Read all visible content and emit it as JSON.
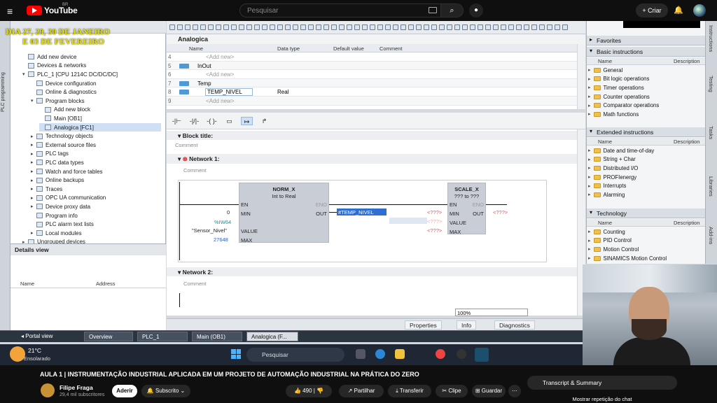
{
  "youtube": {
    "brand": "YouTube",
    "region": "BR",
    "search_placeholder": "Pesquisar",
    "criar_label": "Criar",
    "video_title": "AULA 1 | INSTRUMENTAÇÃO INDUSTRIAL APLICADA EM UM PROJETO DE AUTOMAÇÃO INDUSTRIAL NA PRÁTICA DO ZERO",
    "channel_name": "Filipe Fraga",
    "channel_subs": "29,4 mil subscritores",
    "aderir": "Aderir",
    "subscrito": "Subscrito",
    "likes": "490",
    "partilhar": "Partilhar",
    "transferir": "Transferir",
    "clipe": "Clipe",
    "guardar": "Guardar",
    "transcript": "Transcript & Summary",
    "chat": "Mostrar repetição do chat"
  },
  "overlay": {
    "line1": "DIA 27, 29, 30 DE JANEIRO",
    "line2": "E 03 DE FEVEREIRO"
  },
  "tia": {
    "left_tab": "PLC programming",
    "tree": [
      {
        "label": "Add new device",
        "level": 1,
        "toggle": ""
      },
      {
        "label": "Devices & networks",
        "level": 1,
        "toggle": ""
      },
      {
        "label": "PLC_1 [CPU 1214C DC/DC/DC]",
        "level": 1,
        "toggle": "▾"
      },
      {
        "label": "Device configuration",
        "level": 2,
        "toggle": ""
      },
      {
        "label": "Online & diagnostics",
        "level": 2,
        "toggle": ""
      },
      {
        "label": "Program blocks",
        "level": 2,
        "toggle": "▾"
      },
      {
        "label": "Add new block",
        "level": 3,
        "toggle": ""
      },
      {
        "label": "Main [OB1]",
        "level": 3,
        "toggle": ""
      },
      {
        "label": "Analogica [FC1]",
        "level": 3,
        "toggle": "",
        "selected": true
      },
      {
        "label": "Technology objects",
        "level": 2,
        "toggle": "▸"
      },
      {
        "label": "External source files",
        "level": 2,
        "toggle": "▸"
      },
      {
        "label": "PLC tags",
        "level": 2,
        "toggle": "▸"
      },
      {
        "label": "PLC data types",
        "level": 2,
        "toggle": "▸"
      },
      {
        "label": "Watch and force tables",
        "level": 2,
        "toggle": "▸"
      },
      {
        "label": "Online backups",
        "level": 2,
        "toggle": "▸"
      },
      {
        "label": "Traces",
        "level": 2,
        "toggle": "▸"
      },
      {
        "label": "OPC UA communication",
        "level": 2,
        "toggle": "▸"
      },
      {
        "label": "Device proxy data",
        "level": 2,
        "toggle": "▸"
      },
      {
        "label": "Program info",
        "level": 2,
        "toggle": ""
      },
      {
        "label": "PLC alarm text lists",
        "level": 2,
        "toggle": ""
      },
      {
        "label": "Local modules",
        "level": 2,
        "toggle": "▸"
      },
      {
        "label": "Ungrouped devices",
        "level": 1,
        "toggle": "▸"
      }
    ],
    "details": {
      "title": "Details view",
      "col_name": "Name",
      "col_address": "Address"
    },
    "block_name": "Analogica",
    "iface_cols": {
      "name": "Name",
      "type": "Data type",
      "default": "Default value",
      "comment": "Comment"
    },
    "iface_rows": [
      {
        "n": "4",
        "label": "<Add new>",
        "type": "",
        "kind": "add"
      },
      {
        "n": "5",
        "label": "InOut",
        "type": "",
        "kind": "section"
      },
      {
        "n": "6",
        "label": "<Add new>",
        "type": "",
        "kind": "add"
      },
      {
        "n": "7",
        "label": "Temp",
        "type": "",
        "kind": "section"
      },
      {
        "n": "8",
        "label": "TEMP_NIVEL",
        "type": "Real",
        "kind": "var"
      },
      {
        "n": "9",
        "label": "<Add new>",
        "type": "",
        "kind": "add"
      }
    ],
    "block_title": "Block title:",
    "comment": "Comment",
    "network1": "Network 1:",
    "network2": "Network 2:",
    "norm": {
      "name": "NORM_X",
      "sub": "Int to Real",
      "en": "EN",
      "eno": "ENO",
      "min": "MIN",
      "value": "VALUE",
      "max": "MAX",
      "out": "OUT",
      "min_val": "0",
      "tag_addr": "%IW64",
      "tag_name": "\"Sensor_Nivel\"",
      "max_val": "27648",
      "out_val": "#TEMP_NIVEL"
    },
    "scale": {
      "name": "SCALE_X",
      "sub": "??? to ???",
      "en": "EN",
      "eno": "ENO",
      "min": "MIN",
      "value": "VALUE",
      "max": "MAX",
      "out": "OUT",
      "ph": "<???>"
    },
    "zoom": "100%",
    "right": {
      "favorites": "Favorites",
      "basic": "Basic instructions",
      "extended": "Extended instructions",
      "technology": "Technology",
      "col_name": "Name",
      "col_desc": "Description",
      "basic_items": [
        "General",
        "Bit logic operations",
        "Timer operations",
        "Counter operations",
        "Comparator operations",
        "Math functions"
      ],
      "ext_items": [
        "Date and time-of-day",
        "String + Char",
        "Distributed I/O",
        "PROFIenergy",
        "Interrupts",
        "Alarming"
      ],
      "tech_items": [
        "Counting",
        "PID Control",
        "Motion Control",
        "SINAMICS Motion Control"
      ],
      "vtabs": [
        "Instructions",
        "Testing",
        "Tasks",
        "Libraries",
        "Add-ins"
      ]
    },
    "props": {
      "properties": "Properties",
      "info": "Info",
      "diagnostics": "Diagnostics"
    },
    "portal": {
      "view": "Portal view",
      "tabs": [
        "Overview",
        "PLC_1",
        "Main (OB1)",
        "Analogica (F..."
      ]
    }
  },
  "windows": {
    "temp": "21°C",
    "weather": "Ensolarado",
    "search": "Pesquisar"
  }
}
